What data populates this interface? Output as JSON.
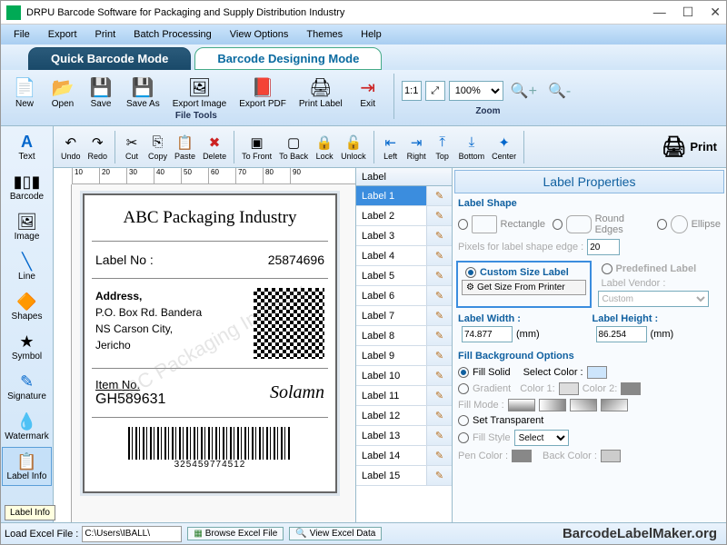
{
  "window": {
    "title": "DRPU Barcode Software for Packaging and Supply Distribution Industry"
  },
  "menubar": [
    "File",
    "Export",
    "Print",
    "Batch Processing",
    "View Options",
    "Themes",
    "Help"
  ],
  "modes": {
    "quick": "Quick Barcode Mode",
    "design": "Barcode Designing Mode"
  },
  "file_toolbar": {
    "group_label": "File Tools",
    "items": [
      "New",
      "Open",
      "Save",
      "Save As",
      "Export Image",
      "Export PDF",
      "Print Label",
      "Exit"
    ],
    "zoom_label": "Zoom",
    "zoom_value": "100%"
  },
  "sidebar": {
    "items": [
      "Text",
      "Barcode",
      "Image",
      "Line",
      "Shapes",
      "Symbol",
      "Signature",
      "Watermark",
      "Label Info"
    ],
    "tooltip": "Label Info"
  },
  "edit_toolbar": {
    "items": [
      "Undo",
      "Redo",
      "Cut",
      "Copy",
      "Paste",
      "Delete",
      "To Front",
      "To Back",
      "Lock",
      "Unlock",
      "Left",
      "Right",
      "Top",
      "Bottom",
      "Center"
    ],
    "print": "Print"
  },
  "ruler": [
    "10",
    "20",
    "30",
    "40",
    "50",
    "60",
    "70",
    "80",
    "90"
  ],
  "label_card": {
    "company": "ABC Packaging Industry",
    "label_no_lbl": "Label No :",
    "label_no": "25874696",
    "addr_lbl": "Address,",
    "addr_lines": [
      "P.O. Box Rd. Bandera",
      "NS Carson City,",
      "Jericho"
    ],
    "item_lbl": "Item No.",
    "item_no": "GH589631",
    "signature": "Solamn",
    "barcode_num": "325459774512",
    "watermark": "ABC Packaging Industry"
  },
  "label_list": {
    "header": "Label",
    "items": [
      "Label 1",
      "Label 2",
      "Label 3",
      "Label 4",
      "Label 5",
      "Label 6",
      "Label 7",
      "Label 8",
      "Label 9",
      "Label 10",
      "Label 11",
      "Label 12",
      "Label 13",
      "Label 14",
      "Label 15"
    ]
  },
  "props": {
    "title": "Label Properties",
    "shape_section": "Label Shape",
    "shapes": {
      "rect": "Rectangle",
      "round": "Round Edges",
      "ellipse": "Ellipse"
    },
    "pixel_edge_lbl": "Pixels for label shape edge :",
    "pixel_edge": "20",
    "custom_size": "Custom Size Label",
    "predefined": "Predefined Label",
    "get_size": "Get Size From Printer",
    "vendor_lbl": "Label Vendor :",
    "vendor": "Custom",
    "width_lbl": "Label Width :",
    "width": "74.877",
    "height_lbl": "Label Height :",
    "height": "86.254",
    "unit": "(mm)",
    "fill_section": "Fill Background Options",
    "fill_solid": "Fill Solid",
    "select_color": "Select Color :",
    "gradient": "Gradient",
    "color1": "Color 1:",
    "color2": "Color 2:",
    "fill_mode": "Fill Mode :",
    "transparent": "Set Transparent",
    "fill_style": "Fill Style",
    "select": "Select",
    "pen_color": "Pen Color :",
    "back_color": "Back Color :"
  },
  "bottom": {
    "load_lbl": "Load Excel File :",
    "path": "C:\\Users\\IBALL\\",
    "browse": "Browse Excel File",
    "view": "View Excel Data",
    "brand": "BarcodeLabelMaker.org"
  }
}
